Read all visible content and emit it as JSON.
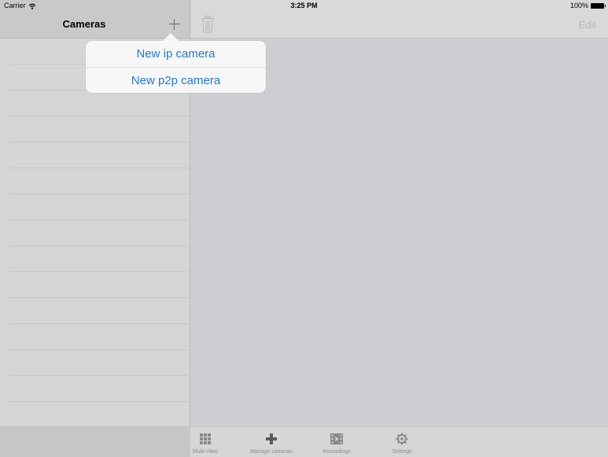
{
  "status_bar": {
    "carrier": "Carrier",
    "time": "3:25 PM",
    "battery": "100%"
  },
  "sidebar": {
    "title": "Cameras",
    "row_count": 15
  },
  "detail": {
    "edit_label": "Edit"
  },
  "popover": {
    "items": [
      {
        "label": "New ip camera"
      },
      {
        "label": "New p2p camera"
      }
    ]
  },
  "tab_bar": {
    "items": [
      {
        "label": "Multi-View",
        "icon": "grid-icon"
      },
      {
        "label": "Manage cameras",
        "icon": "plus-icon"
      },
      {
        "label": "Recordings",
        "icon": "film-icon"
      },
      {
        "label": "Settings",
        "icon": "gear-icon"
      }
    ]
  },
  "colors": {
    "accent": "#1f7bde",
    "background": "#cecdd2",
    "sidebar": "#d5d5d5"
  }
}
